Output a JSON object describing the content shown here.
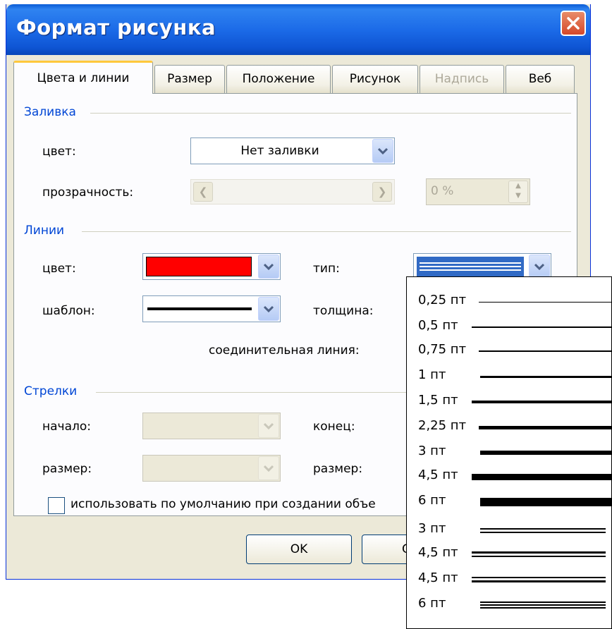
{
  "window": {
    "title": "Формат рисунка"
  },
  "tabs": [
    {
      "label": "Цвета и линии",
      "active": true,
      "disabled": false
    },
    {
      "label": "Размер",
      "active": false,
      "disabled": false
    },
    {
      "label": "Положение",
      "active": false,
      "disabled": false
    },
    {
      "label": "Рисунок",
      "active": false,
      "disabled": false
    },
    {
      "label": "Надпись",
      "active": false,
      "disabled": true
    },
    {
      "label": "Веб",
      "active": false,
      "disabled": false
    }
  ],
  "fill": {
    "group_label": "Заливка",
    "color_label": "цвет:",
    "color_value": "Нет заливки",
    "transparency_label": "прозрачность:",
    "transparency_value": "0 %"
  },
  "lines": {
    "group_label": "Линии",
    "color_label": "цвет:",
    "color_value": "#ff0000",
    "type_label": "тип:",
    "pattern_label": "шаблон:",
    "weight_label": "толщина:",
    "connector_label": "соединительная линия:"
  },
  "arrows": {
    "group_label": "Стрелки",
    "begin_style_label": "начало:",
    "end_style_label": "конец:",
    "begin_size_label": "размер:",
    "end_size_label": "размер:"
  },
  "default_checkbox": {
    "label": "использовать по умолчанию при создании объе",
    "checked": false
  },
  "buttons": {
    "ok": "OK",
    "cancel": "Отм"
  },
  "line_type_dropdown": {
    "items": [
      {
        "label": "0,25 пт",
        "style": "single",
        "weight": 1
      },
      {
        "label": "0,5 пт",
        "style": "single",
        "weight": 1.5
      },
      {
        "label": "0,75 пт",
        "style": "single",
        "weight": 2
      },
      {
        "label": "1 пт",
        "style": "single",
        "weight": 3
      },
      {
        "label": "1,5 пт",
        "style": "single",
        "weight": 4
      },
      {
        "label": "2,25 пт",
        "style": "single",
        "weight": 5
      },
      {
        "label": "3 пт",
        "style": "single",
        "weight": 6
      },
      {
        "label": "4,5 пт",
        "style": "single",
        "weight": 9
      },
      {
        "label": "6 пт",
        "style": "single",
        "weight": 12
      },
      {
        "label": "3 пт",
        "style": "double",
        "weight": 7
      },
      {
        "label": "4,5 пт",
        "style": "double-thick-thin",
        "weight": 8
      },
      {
        "label": "4,5 пт",
        "style": "double-thin-thick",
        "weight": 8
      },
      {
        "label": "6 пт",
        "style": "triple",
        "weight": 10
      }
    ]
  },
  "colors": {
    "titlebar": "#1c6be8",
    "group_label": "#0046d5",
    "disabled_text": "#aca899"
  }
}
